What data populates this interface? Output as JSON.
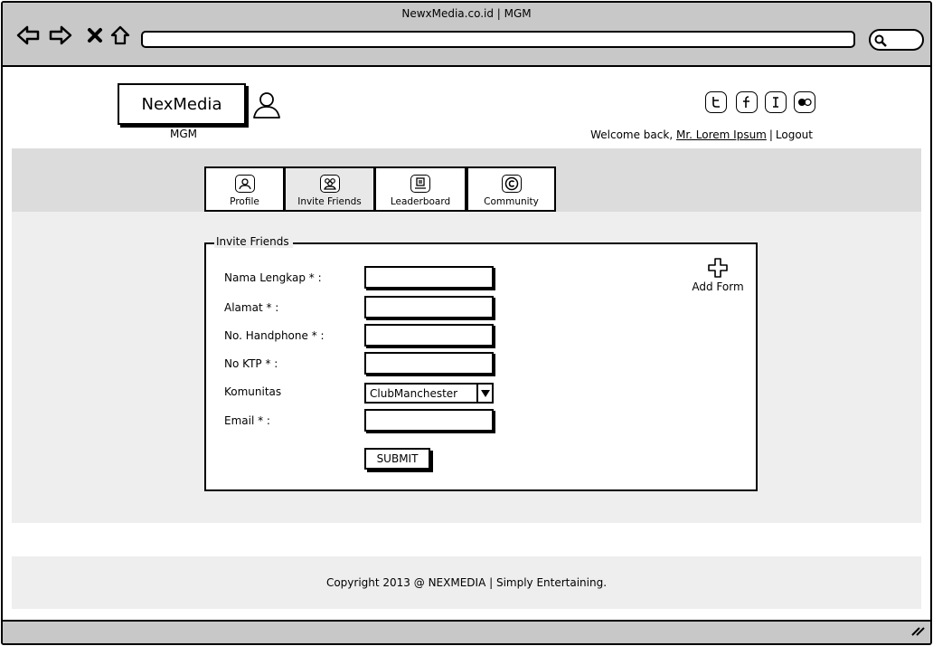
{
  "browser": {
    "title": "NewxMedia.co.id | MGM",
    "url": "",
    "icons": [
      "back-icon",
      "forward-icon",
      "close-icon",
      "home-icon",
      "search-icon"
    ]
  },
  "header": {
    "logo": "NexMedia",
    "logo_sub": "MGM",
    "social_icons": [
      "twitter-icon",
      "facebook-icon",
      "instagram-icon",
      "flickr-icon"
    ],
    "welcome_prefix": "Welcome back,",
    "user_name": "Mr. Lorem Ipsum",
    "separator": "|",
    "logout": "Logout"
  },
  "tabs": [
    {
      "label": "Profile",
      "icon": "profile-icon",
      "glyph": "☺"
    },
    {
      "label": "Invite Friends",
      "icon": "invite-friends-icon",
      "glyph": "☻"
    },
    {
      "label": "Leaderboard",
      "icon": "leaderboard-icon",
      "glyph": "▤"
    },
    {
      "label": "Community",
      "icon": "community-icon",
      "glyph": "©"
    }
  ],
  "active_tab": "Invite Friends",
  "form": {
    "legend": "Invite Friends",
    "fields": [
      {
        "label": "Nama Lengkap * :",
        "value": ""
      },
      {
        "label": "Alamat * :",
        "value": ""
      },
      {
        "label": "No. Handphone * :",
        "value": ""
      },
      {
        "label": "No KTP * :",
        "value": ""
      },
      {
        "label": "Komunitas",
        "value": "ClubManchester"
      },
      {
        "label": "Email * :",
        "value": ""
      }
    ],
    "submit_label": "SUBMIT",
    "add_form_label": "Add Form"
  },
  "footer": {
    "text": "Copyright 2013 @ NEXMEDIA | Simply Entertaining."
  }
}
